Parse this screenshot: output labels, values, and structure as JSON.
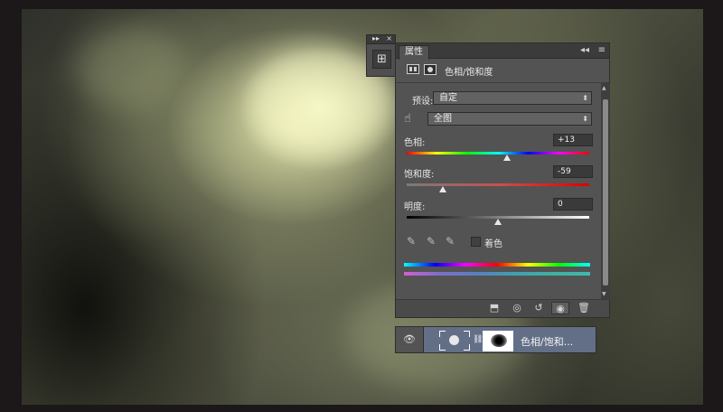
{
  "colors": {
    "accent_layer": "#626f86",
    "panel_bg": "#535353",
    "dark_bar": "#3b3b3b"
  },
  "mini_panel": {
    "collapse_icon": "▸▸",
    "close_icon": "×",
    "button_icon": "properties-panel-icon"
  },
  "properties": {
    "tab_label": "属性",
    "collapse_icon": "◂◂",
    "menu_icon": "≡",
    "header_title": "色相/饱和度",
    "preset_label": "预设:",
    "preset_value": "自定",
    "range_value": "全图",
    "hue_label": "色相:",
    "hue_value": "+13",
    "hue_level": 0.55,
    "saturation_label": "饱和度:",
    "saturation_value": "-59",
    "saturation_level": 0.2,
    "lightness_label": "明度:",
    "lightness_value": "0",
    "lightness_level": 0.5,
    "colorize_label": "着色",
    "colorize_checked": false
  },
  "footer_icons": [
    "clip-to-layer-icon",
    "view-previous-icon",
    "reset-icon",
    "visibility-icon",
    "trash-icon"
  ],
  "layer": {
    "name": "色相/饱和...",
    "visible": true
  }
}
